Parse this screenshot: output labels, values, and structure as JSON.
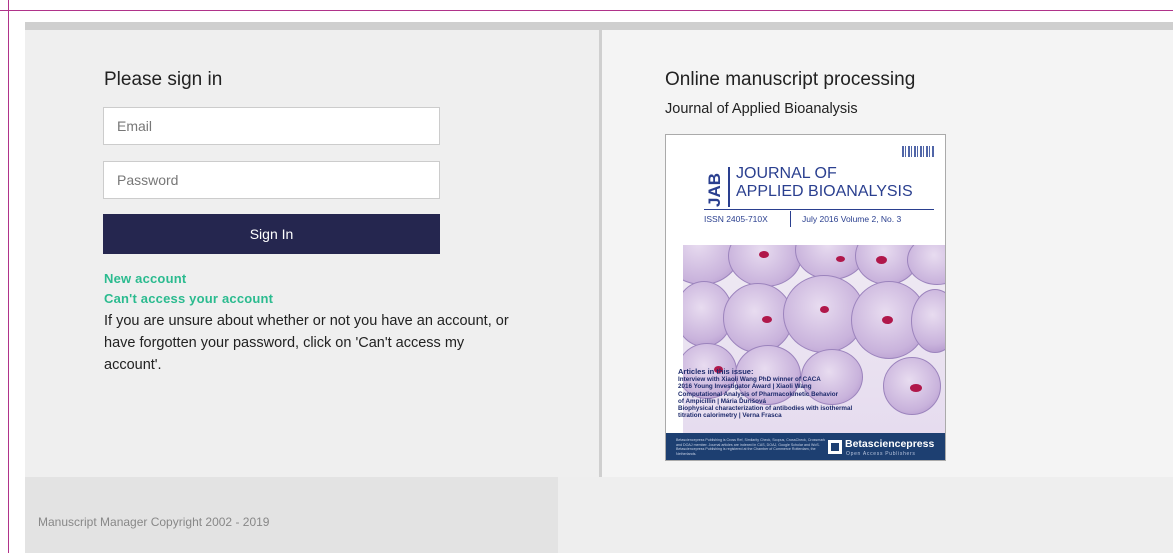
{
  "signin": {
    "title": "Please sign in",
    "email_placeholder": "Email",
    "password_placeholder": "Password",
    "button_label": "Sign In",
    "link_new_account": "New account",
    "link_cant_access": "Can't access your account",
    "help_text": "If you are unsure about whether or not you have an account, or have forgotten your password, click on 'Can't access my account'."
  },
  "right": {
    "title": "Online manuscript processing",
    "journal_name": "Journal of Applied Bioanalysis"
  },
  "cover": {
    "logo_letters": "JAB",
    "title_line1": "JOURNAL OF",
    "title_line2": "APPLIED BIOANALYSIS",
    "issn": "ISSN 2405-710X",
    "issue_date": "July 2016 Volume 2, No. 3",
    "articles_header": "Articles in this issue:",
    "articles": [
      "Interview with Xiaoli Wang PhD winner of CACA",
      "2016 Young Investigator Award | Xiaoli Wang",
      "Computational Analysis of Pharmacokinetic Behavior",
      "of Ampicillin | Mária Ďurišová",
      "Biophysical characterization of antibodies with isothermal",
      "titration calorimetry | Verna Frasca"
    ],
    "footer_fineprint": "Betasciencepress Publishing is Cross Ref, Similarity Check, Scopus, CrossCheck, Crossmark and DOAJ member. Journal articles are indexed in CAS, DOAJ, Google Scholar and WoS. Betasciencepress Publishing is registered at the Chamber of Commerce Rotterdam, the Netherlands.",
    "publisher_name": "Betasciencepress",
    "publisher_tagline": "Open Access Publishers",
    "colors": {
      "brand_blue": "#2a3f8f",
      "footer_navy": "#1d3f71",
      "nucleus": "#b0174a"
    }
  },
  "footer": {
    "copyright": "Manuscript Manager Copyright 2002 - 2019"
  },
  "colors": {
    "button_bg": "#25264f",
    "link_green": "#2bbb8f",
    "frame_magenta": "#b0338a"
  }
}
